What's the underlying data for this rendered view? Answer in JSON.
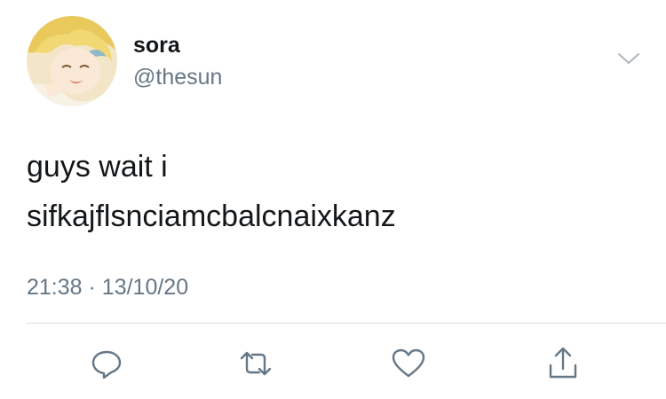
{
  "user": {
    "display_name": "sora",
    "handle": "@thesun"
  },
  "tweet": {
    "lines": [
      "guys wait i",
      "sifkajflsnciamcbalcnaixkanz"
    ],
    "time": "21:38",
    "separator": "·",
    "date": "13/10/20"
  },
  "icons": {
    "menu": "chevron-down-icon",
    "reply": "speech-bubble-icon",
    "retweet": "retweet-arrows-icon",
    "like": "heart-outline-icon",
    "share": "share-upload-icon"
  },
  "colors": {
    "text": "#14171a",
    "secondary": "#657786",
    "icon": "#657786",
    "divider": "#d9dde1"
  }
}
